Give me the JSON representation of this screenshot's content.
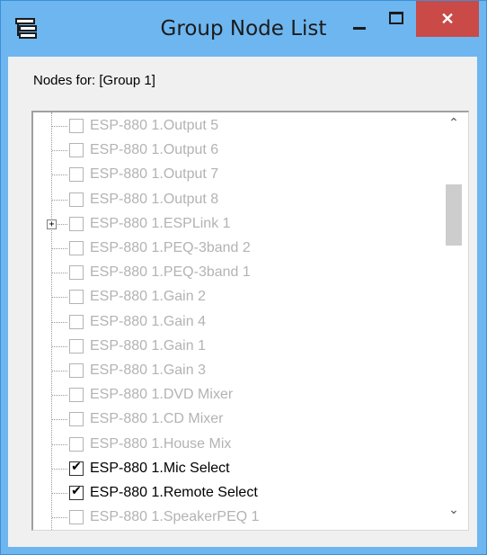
{
  "window": {
    "title": "Group Node List",
    "icon": "node-list-icon",
    "controls": {
      "minimize": "minimize-icon",
      "maximize": "maximize-icon",
      "close": "✕"
    },
    "colors": {
      "frame": "#6eb6f0",
      "close": "#c94a47"
    }
  },
  "nodes_label": "Nodes for: [Group 1]",
  "tree": {
    "items": [
      {
        "label": "ESP-880 1.Output 5",
        "checked": false,
        "enabled": false,
        "expandable": false
      },
      {
        "label": "ESP-880 1.Output 6",
        "checked": false,
        "enabled": false,
        "expandable": false
      },
      {
        "label": "ESP-880 1.Output 7",
        "checked": false,
        "enabled": false,
        "expandable": false
      },
      {
        "label": "ESP-880 1.Output 8",
        "checked": false,
        "enabled": false,
        "expandable": false
      },
      {
        "label": "ESP-880 1.ESPLink 1",
        "checked": false,
        "enabled": false,
        "expandable": true
      },
      {
        "label": "ESP-880 1.PEQ-3band 2",
        "checked": false,
        "enabled": false,
        "expandable": false
      },
      {
        "label": "ESP-880 1.PEQ-3band 1",
        "checked": false,
        "enabled": false,
        "expandable": false
      },
      {
        "label": "ESP-880 1.Gain 2",
        "checked": false,
        "enabled": false,
        "expandable": false
      },
      {
        "label": "ESP-880 1.Gain 4",
        "checked": false,
        "enabled": false,
        "expandable": false
      },
      {
        "label": "ESP-880 1.Gain 1",
        "checked": false,
        "enabled": false,
        "expandable": false
      },
      {
        "label": "ESP-880 1.Gain 3",
        "checked": false,
        "enabled": false,
        "expandable": false
      },
      {
        "label": "ESP-880 1.DVD Mixer",
        "checked": false,
        "enabled": false,
        "expandable": false
      },
      {
        "label": "ESP-880 1.CD Mixer",
        "checked": false,
        "enabled": false,
        "expandable": false
      },
      {
        "label": "ESP-880 1.House Mix",
        "checked": false,
        "enabled": false,
        "expandable": false
      },
      {
        "label": "ESP-880 1.Mic Select",
        "checked": true,
        "enabled": true,
        "expandable": false
      },
      {
        "label": "ESP-880 1.Remote Select",
        "checked": true,
        "enabled": true,
        "expandable": false
      },
      {
        "label": "ESP-880 1.SpeakerPEQ 1",
        "checked": false,
        "enabled": false,
        "expandable": false
      }
    ]
  },
  "scrollbar": {
    "up": "⌃",
    "down": "⌄"
  }
}
